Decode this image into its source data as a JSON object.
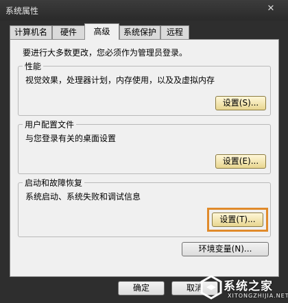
{
  "window": {
    "title": "系统属性"
  },
  "tabs": [
    {
      "label": "计算机名"
    },
    {
      "label": "硬件"
    },
    {
      "label": "高级",
      "active": true
    },
    {
      "label": "系统保护"
    },
    {
      "label": "远程"
    }
  ],
  "intro": "要进行大多数更改，您必须作为管理员登录。",
  "groups": {
    "performance": {
      "title": "性能",
      "desc": "视觉效果，处理器计划，内存使用，以及及虚拟内存",
      "button": "设置(S)..."
    },
    "profiles": {
      "title": "用户配置文件",
      "desc": "与您登录有关的桌面设置",
      "button": "设置(E)..."
    },
    "startup": {
      "title": "启动和故障恢复",
      "desc": "系统启动、系统失败和调试信息",
      "button": "设置(T)..."
    }
  },
  "env_button": "环境变量(N)...",
  "footer": {
    "ok_label": "确定",
    "cancel_label": "取消"
  },
  "watermark": {
    "text": "系统之家",
    "url": "XITONGZHIJIA.NET"
  },
  "colors": {
    "highlight": "#e08a2a",
    "dark_bg": "#2e2e2e"
  }
}
